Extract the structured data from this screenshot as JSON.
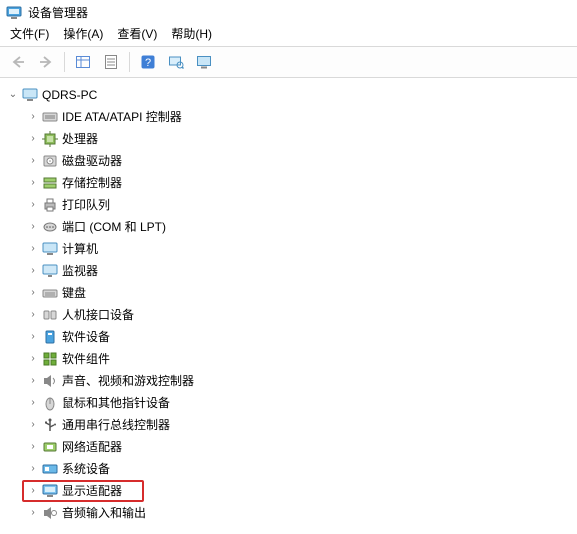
{
  "window": {
    "title": "设备管理器"
  },
  "menu": {
    "file": "文件(F)",
    "action": "操作(A)",
    "view": "查看(V)",
    "help": "帮助(H)"
  },
  "toolbar": {
    "back": "back",
    "forward": "forward",
    "show_hidden": "show-hidden",
    "properties": "properties",
    "help": "help",
    "scan": "scan",
    "monitor": "monitor"
  },
  "tree": {
    "root": {
      "label": "QDRS-PC",
      "expanded": true
    },
    "items": [
      {
        "icon": "ide",
        "label": "IDE ATA/ATAPI 控制器"
      },
      {
        "icon": "cpu",
        "label": "处理器"
      },
      {
        "icon": "disk",
        "label": "磁盘驱动器"
      },
      {
        "icon": "storage",
        "label": "存储控制器"
      },
      {
        "icon": "printer",
        "label": "打印队列"
      },
      {
        "icon": "port",
        "label": "端口 (COM 和 LPT)"
      },
      {
        "icon": "computer",
        "label": "计算机"
      },
      {
        "icon": "monitor",
        "label": "监视器"
      },
      {
        "icon": "keyboard",
        "label": "键盘"
      },
      {
        "icon": "hid",
        "label": "人机接口设备"
      },
      {
        "icon": "software",
        "label": "软件设备"
      },
      {
        "icon": "component",
        "label": "软件组件"
      },
      {
        "icon": "audio",
        "label": "声音、视频和游戏控制器"
      },
      {
        "icon": "mouse",
        "label": "鼠标和其他指针设备"
      },
      {
        "icon": "usb",
        "label": "通用串行总线控制器"
      },
      {
        "icon": "network",
        "label": "网络适配器"
      },
      {
        "icon": "system",
        "label": "系统设备"
      },
      {
        "icon": "display",
        "label": "显示适配器",
        "highlight": true
      },
      {
        "icon": "audioio",
        "label": "音频输入和输出"
      }
    ]
  },
  "colors": {
    "highlight_border": "#d62c2c"
  }
}
